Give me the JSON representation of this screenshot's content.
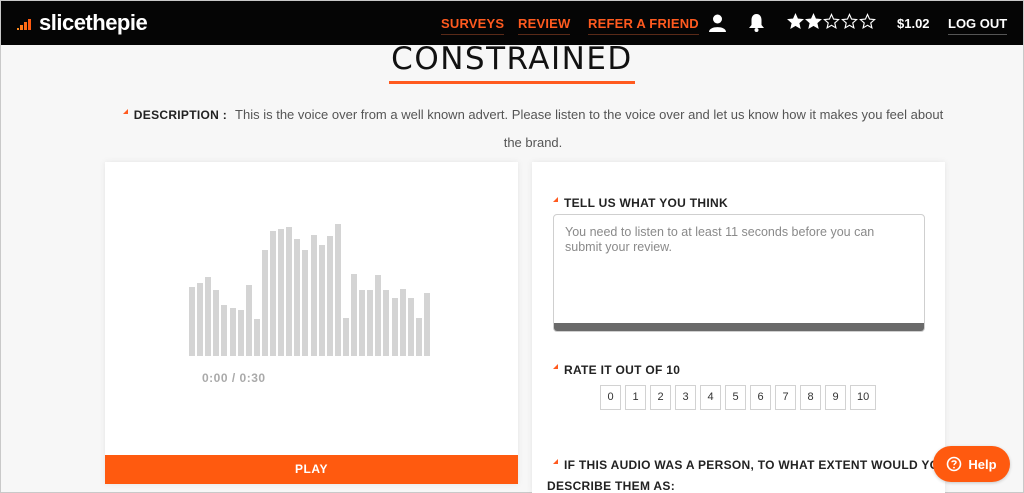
{
  "brand": {
    "logo_text": "slicethepie",
    "accent": "#ff5a1f"
  },
  "nav": {
    "surveys": "SURVEYS",
    "review": "REVIEW",
    "refer": "REFER A FRIEND",
    "balance": "$1.02",
    "logout": "LOG OUT",
    "star_rating": 2,
    "star_max": 5,
    "icons": [
      "user-icon",
      "bell-icon"
    ]
  },
  "page": {
    "title": "CONSTRAINED",
    "description_label": "DESCRIPTION :",
    "description_text": "This is the voice over from a well known advert. Please listen to the voice over and let us know how it makes you feel about the brand."
  },
  "player": {
    "time": "0:00 / 0:30",
    "play_label": "PLAY",
    "waveform_levels": [
      0.52,
      0.55,
      0.6,
      0.5,
      0.39,
      0.36,
      0.35,
      0.54,
      0.28,
      0.8,
      0.95,
      0.96,
      0.98,
      0.89,
      0.8,
      0.92,
      0.84,
      0.91,
      1.0,
      0.29,
      0.62,
      0.5,
      0.5,
      0.61,
      0.5,
      0.44,
      0.51,
      0.44,
      0.29,
      0.48,
      0.0
    ]
  },
  "review": {
    "tell_us_label": "TELL US WHAT YOU THINK",
    "review_placeholder": "You need to listen to at least 11 seconds before you can submit your review.",
    "rate_label": "RATE IT OUT OF 10",
    "rating_options": [
      "0",
      "1",
      "2",
      "3",
      "4",
      "5",
      "6",
      "7",
      "8",
      "9",
      "10"
    ],
    "person_question": "IF THIS AUDIO WAS A PERSON, TO WHAT EXTENT WOULD YOU DESCRIBE THEM AS:"
  },
  "help": {
    "label": "Help"
  }
}
